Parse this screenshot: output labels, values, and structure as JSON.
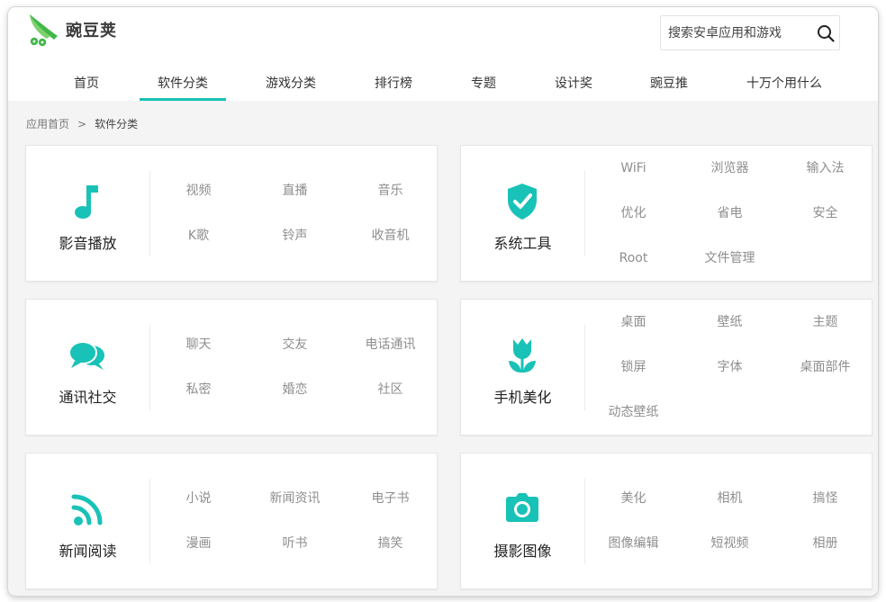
{
  "header": {
    "brand": "豌豆荚",
    "search_placeholder": "搜索安卓应用和游戏",
    "accent_color": "#18c2b7",
    "logo_color": "#40b848"
  },
  "nav": {
    "items": [
      {
        "label": "首页",
        "active": false
      },
      {
        "label": "软件分类",
        "active": true
      },
      {
        "label": "游戏分类",
        "active": false
      },
      {
        "label": "排行榜",
        "active": false
      },
      {
        "label": "专题",
        "active": false
      },
      {
        "label": "设计奖",
        "active": false
      },
      {
        "label": "豌豆推",
        "active": false
      },
      {
        "label": "十万个用什么",
        "active": false
      }
    ]
  },
  "breadcrumb": {
    "home": "应用首页",
    "separator": ">",
    "current": "软件分类"
  },
  "categories": [
    {
      "title": "影音播放",
      "icon": "music-note-icon",
      "links": [
        "视频",
        "直播",
        "音乐",
        "K歌",
        "铃声",
        "收音机"
      ]
    },
    {
      "title": "系统工具",
      "icon": "shield-check-icon",
      "links": [
        "WiFi",
        "浏览器",
        "输入法",
        "优化",
        "省电",
        "安全",
        "Root",
        "文件管理"
      ]
    },
    {
      "title": "通讯社交",
      "icon": "chat-bubbles-icon",
      "links": [
        "聊天",
        "交友",
        "电话通讯",
        "私密",
        "婚恋",
        "社区"
      ]
    },
    {
      "title": "手机美化",
      "icon": "tulip-icon",
      "links": [
        "桌面",
        "壁纸",
        "主题",
        "锁屏",
        "字体",
        "桌面部件",
        "动态壁纸"
      ]
    },
    {
      "title": "新闻阅读",
      "icon": "rss-feed-icon",
      "links": [
        "小说",
        "新闻资讯",
        "电子书",
        "漫画",
        "听书",
        "搞笑"
      ]
    },
    {
      "title": "摄影图像",
      "icon": "camera-icon",
      "links": [
        "美化",
        "相机",
        "搞怪",
        "图像编辑",
        "短视频",
        "相册"
      ]
    }
  ]
}
